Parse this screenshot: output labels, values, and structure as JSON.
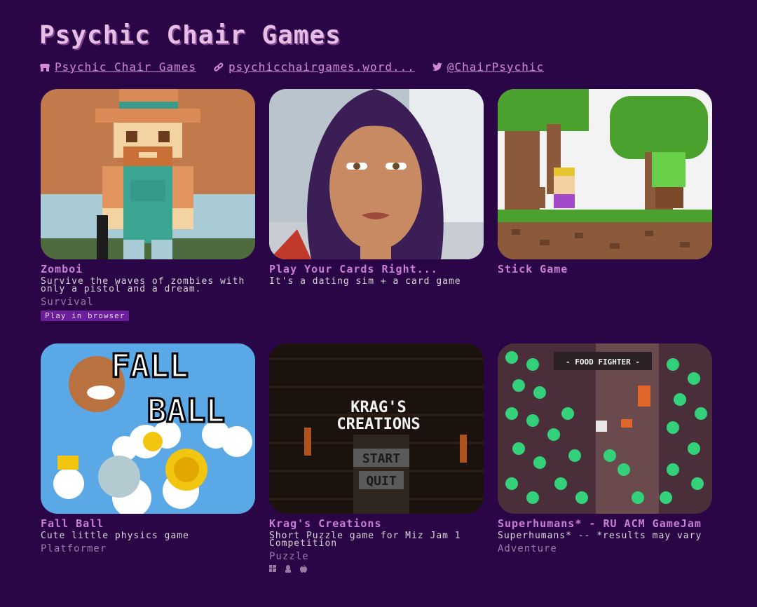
{
  "header": {
    "title": "Psychic Chair Games",
    "links": [
      {
        "icon": "store-icon",
        "label": "Psychic Chair Games"
      },
      {
        "icon": "link-icon",
        "label": "psychicchairgames.word..."
      },
      {
        "icon": "twitter-icon",
        "label": "@ChairPsychic"
      }
    ]
  },
  "games": [
    {
      "title": "Zomboi",
      "desc": "Survive the waves of zombies with only a pistol and a dream.",
      "genre": "Survival",
      "badge": "Play in browser"
    },
    {
      "title": "Play Your Cards Right...",
      "desc": "It's a dating sim + a card game",
      "genre": "",
      "badge": ""
    },
    {
      "title": "Stick Game",
      "desc": "",
      "genre": "",
      "badge": ""
    },
    {
      "title": "Fall Ball",
      "desc": "Cute little physics game",
      "genre": "Platformer",
      "badge": ""
    },
    {
      "title": "Krag's Creations",
      "desc": "Short Puzzle game for Miz Jam 1 Competition",
      "genre": "Puzzle",
      "platforms": [
        "windows-icon",
        "linux-icon",
        "apple-icon"
      ]
    },
    {
      "title": "Superhumans* - RU ACM GameJam",
      "desc": "Superhumans* -- *results may vary",
      "genre": "Adventure",
      "badge": ""
    }
  ],
  "thumb_text": {
    "fall_ball_line1": "FALL",
    "fall_ball_line2": "BALL",
    "krag_title1": "KRAG'S",
    "krag_title2": "CREATIONS",
    "krag_start": "START",
    "krag_quit": "QUIT",
    "food_fighter": "- FOOD FIGHTER -"
  },
  "colors": {
    "background": "#2b0647",
    "title": "#e6bde4",
    "link": "#cf8ad6",
    "game_title": "#c97fd4",
    "badge_bg": "#6a1e9a"
  }
}
